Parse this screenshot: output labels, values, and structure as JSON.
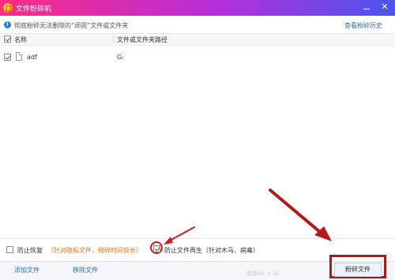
{
  "window": {
    "title": "文件粉碎机",
    "minimize_label": "—",
    "close_label": "✕"
  },
  "info": {
    "icon": "info-icon",
    "text": "彻底粉碎无法删除的“顽固”文件或文件夹",
    "history_link": "查看粉碎历史"
  },
  "table": {
    "header_checked": true,
    "col_name": "名称",
    "col_path": "文件或文件夹路径",
    "rows": [
      {
        "checked": true,
        "icon": "file-icon",
        "name": "adf",
        "path": "G:"
      }
    ]
  },
  "options": {
    "prevent_recovery_checked": false,
    "prevent_recovery_label": "防止恢复",
    "prevent_recovery_hint": "（针对隐私文件，粉碎时间较长）",
    "prevent_regen_checked": true,
    "prevent_regen_label": "防止文件再生（针对木马、病毒）"
  },
  "bottom": {
    "add_file": "添加文件",
    "remove_file": "移除文件",
    "hint": "图源Alt  +  Al",
    "shred_button": "粉碎文件"
  },
  "colors": {
    "title_gradient": [
      "#ff2a86",
      "#b52fd9",
      "#4a55f0"
    ],
    "link": "#2c6fb7",
    "hint": "#e0781e",
    "annotation": "#d21b1b"
  }
}
